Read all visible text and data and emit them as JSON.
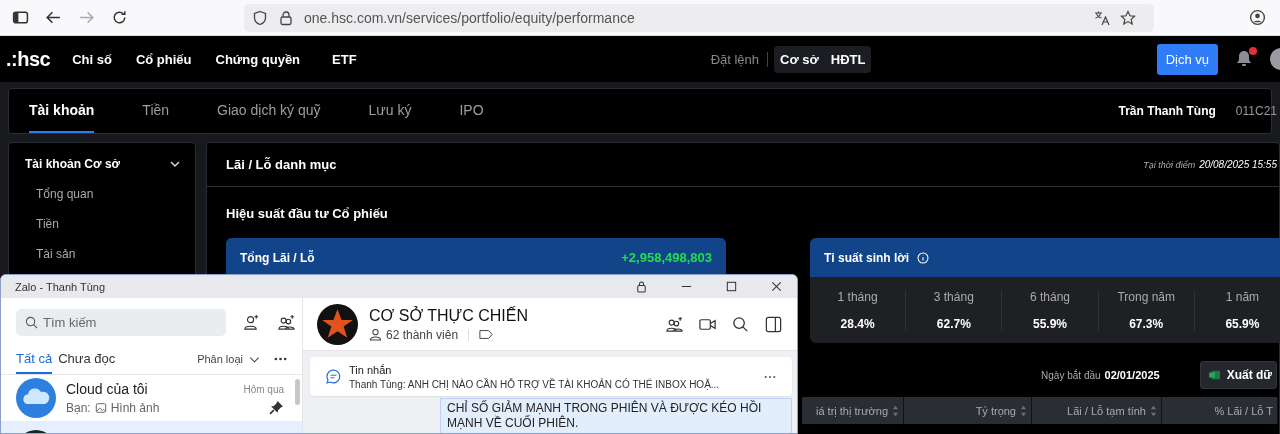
{
  "browser": {
    "url": "one.hsc.com.vn/services/portfolio/equity/performance"
  },
  "nav": {
    "logo": ".:hsc",
    "links": [
      "Chỉ số",
      "Cổ phiếu",
      "Chứng quyền",
      "ETF"
    ],
    "order_label": "Đặt lệnh",
    "segments": [
      "Cơ sở",
      "HĐTL"
    ],
    "service_button": "Dịch vụ",
    "notification_dot": true
  },
  "tabs": [
    {
      "label": "Tài khoản",
      "selected": true
    },
    {
      "label": "Tiền",
      "selected": false
    },
    {
      "label": "Giao dịch ký quỹ",
      "selected": false
    },
    {
      "label": "Lưu ký",
      "selected": false
    },
    {
      "label": "IPO",
      "selected": false
    }
  ],
  "user": {
    "name": "Trần Thanh Tùng",
    "account": "011C21"
  },
  "sidebar": {
    "group": "Tài khoản Cơ sở",
    "expanded": true,
    "items": [
      "Tổng quan",
      "Tiền",
      "Tài sản"
    ]
  },
  "main": {
    "title": "Lãi / Lỗ danh mục",
    "timestamp_label": "Tại thời điểm",
    "timestamp": "20/08/2025 15:55",
    "section_title": "Hiệu suất đầu tư Cổ phiếu",
    "total": {
      "label": "Tổng Lãi / Lỗ",
      "value": "+2,958,498,803"
    },
    "returns": {
      "title": "Tỉ suất sinh lời",
      "periods": [
        {
          "label": "1 tháng",
          "value": "28.4%"
        },
        {
          "label": "3 tháng",
          "value": "62.7%"
        },
        {
          "label": "6 tháng",
          "value": "55.9%"
        },
        {
          "label": "Trong năm",
          "value": "67.3%"
        },
        {
          "label": "1 năm",
          "value": "65.9%"
        }
      ]
    },
    "start_date_label": "Ngày bắt đầu",
    "start_date": "02/01/2025",
    "export_button": "Xuất dữ",
    "columns": [
      "iá trị thị trường",
      "Tỷ trọng",
      "Lãi / Lỗ tạm tính",
      "% Lãi / Lỗ T"
    ]
  },
  "zalo": {
    "title": "Zalo - Thanh Tùng",
    "search_placeholder": "Tìm kiếm",
    "filters": [
      {
        "label": "Tất cả",
        "selected": true
      },
      {
        "label": "Chưa đọc",
        "selected": false
      }
    ],
    "sort_label": "Phân loại",
    "conversations": [
      {
        "kind": "cloud",
        "name": "Cloud của tôi",
        "time": "Hôm qua",
        "preview_sender": "Bạn:",
        "preview": "Hình ảnh",
        "pinned": true,
        "selected": false
      },
      {
        "kind": "avatar",
        "selected": true
      }
    ],
    "chat": {
      "name": "CƠ SỞ THỰC CHIẾN",
      "members": "62 thành viên",
      "pinned_label": "Tin nhắn",
      "pinned_text": "Thanh Tùng: ANH CHỊ NÀO CẦN HỖ TRỢ VỀ TÀI KHOẢN CÓ THỂ INBOX HOẶ...",
      "message": "CHỈ SỐ GIẢM MẠNH TRONG PHIÊN VÀ ĐƯỢC KÉO HỒI MẠNH VỀ CUỐI PHIÊN."
    }
  }
}
